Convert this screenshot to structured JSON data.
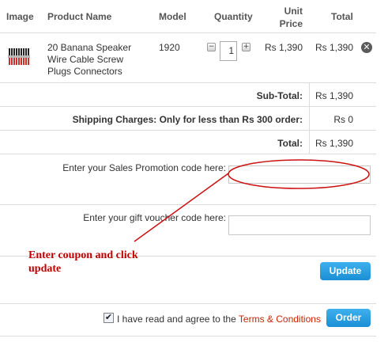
{
  "table_headers": {
    "image": "Image",
    "product_name": "Product Name",
    "model": "Model",
    "quantity": "Quantity",
    "unit_price_line1": "Unit",
    "unit_price_line2": "Price",
    "total": "Total"
  },
  "cart_item": {
    "name_line1": "20 Banana Speaker",
    "name_line2": "Wire Cable Screw",
    "name_line3": "Plugs Connectors",
    "model": "1920",
    "quantity": "1",
    "decrement_symbol": "−",
    "increment_symbol": "+",
    "unit_price": "Rs 1,390",
    "total": "Rs 1,390",
    "remove_symbol": "✕"
  },
  "totals": {
    "subtotal_label": "Sub-Total:",
    "subtotal_value": "Rs 1,390",
    "shipping_label": "Shipping Charges: Only for less than Rs 300 order:",
    "shipping_value": "Rs 0",
    "total_label": "Total:",
    "total_value": "Rs 1,390"
  },
  "promo": {
    "label": "Enter your Sales Promotion code here:",
    "value": ""
  },
  "voucher": {
    "label": "Enter your gift voucher code here:",
    "value": ""
  },
  "annotation": {
    "line1": "Enter coupon and click",
    "line2": "update",
    "color": "#cc0000"
  },
  "update_button": "Update",
  "agreement": {
    "checked": true,
    "check_symbol": "✔",
    "text": "I have read and agree to the",
    "link": "Terms & Conditions",
    "link_color": "#cc2200"
  },
  "order_button": "Order",
  "colors": {
    "button_blue": "#2a9fe0",
    "border": "#dcdcdc"
  }
}
